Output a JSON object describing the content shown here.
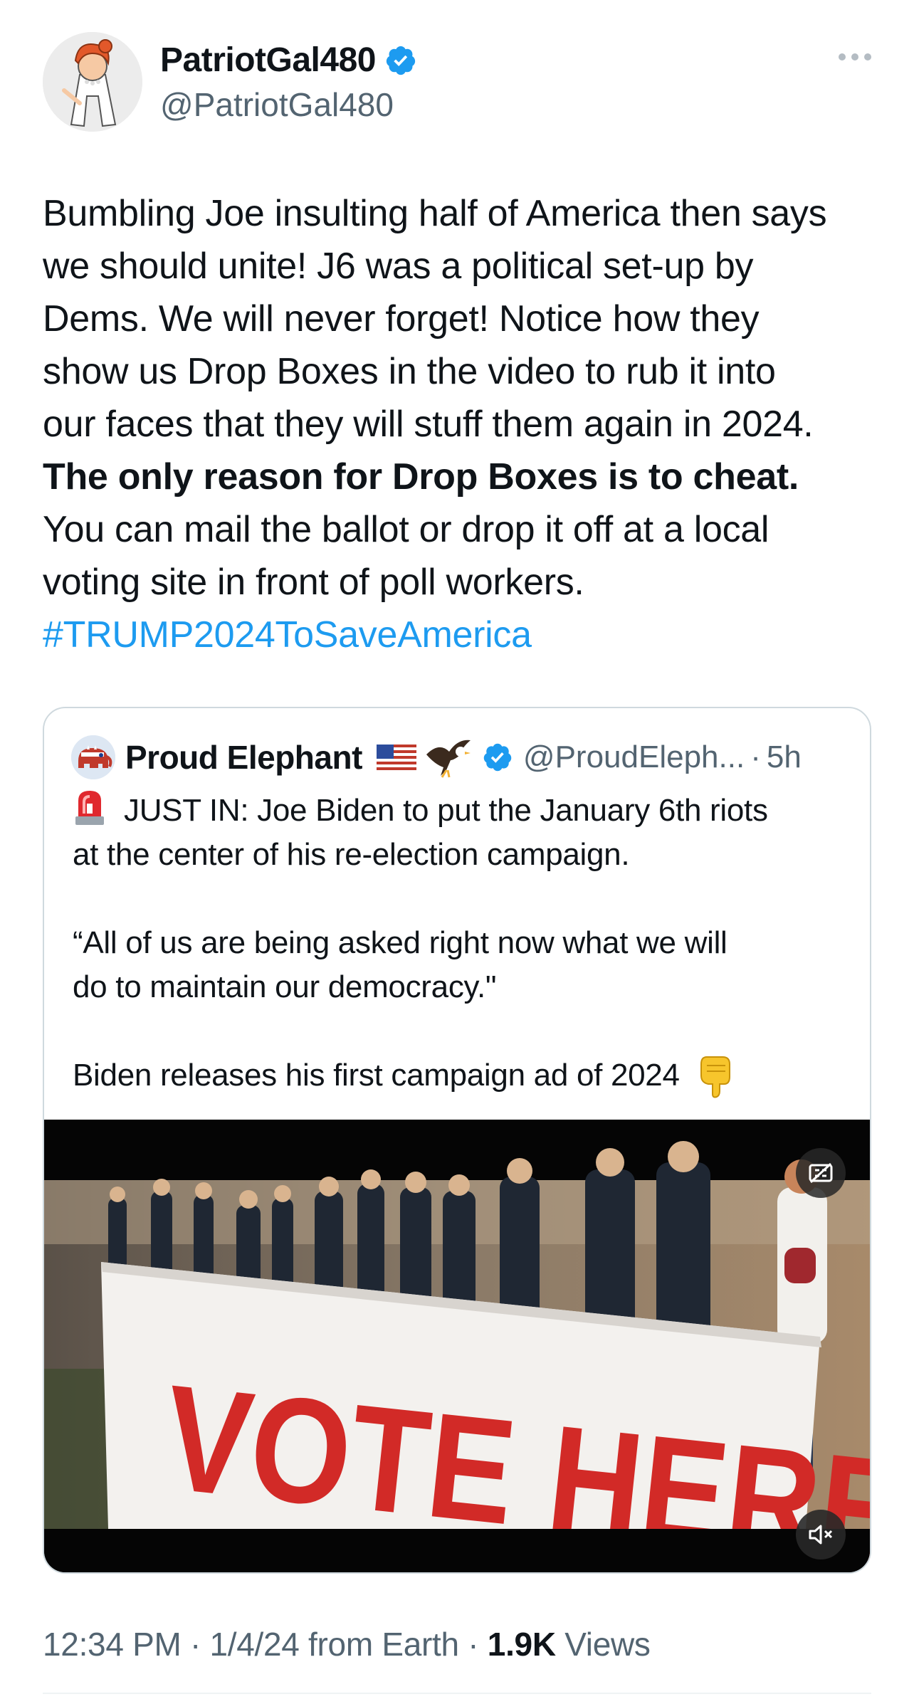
{
  "author": {
    "name": "PatriotGal480",
    "handle": "@PatriotGal480",
    "avatar_icon": "cartoon-character-avatar",
    "verified": true
  },
  "tweet": {
    "lines": [
      "Bumbling Joe insulting half of America then says",
      "we should unite!  J6 was a political set-up by",
      "Dems. We will  never forget!  Notice how they",
      "show us Drop Boxes in the video to rub it into",
      "our faces that they will stuff them again in 2024."
    ],
    "bold_line": "The only reason for Drop Boxes is to cheat.",
    "lines_after": [
      "You can mail the ballot or drop it off at a local",
      "voting site in front of poll workers."
    ],
    "hashtag": "#TRUMP2024ToSaveAmerica"
  },
  "quote": {
    "name": "Proud Elephant",
    "handle": "@ProudEleph...",
    "separator": "·",
    "time": "5h",
    "verified": true,
    "line1": "JUST IN: Joe Biden to put the January 6th riots",
    "line2": "at the center of his re-election campaign.",
    "line3": "“All of us are being asked right now what we will",
    "line4": "do to maintain our democracy.\"",
    "line5": "Biden releases his first campaign ad of 2024",
    "video": {
      "sign_text": "VOTE HERE",
      "captions_icon": "closed-captions-icon",
      "mute_icon": "muted-speaker-icon"
    }
  },
  "meta": {
    "time": "12:34 PM",
    "sep1": " · ",
    "date_source": "1/4/24 from Earth",
    "sep2": " · ",
    "views_count": "1.9K",
    "views_label": " Views"
  },
  "colors": {
    "link": "#1d9bf0",
    "secondary_text": "#536471",
    "border": "#cfd9de"
  }
}
